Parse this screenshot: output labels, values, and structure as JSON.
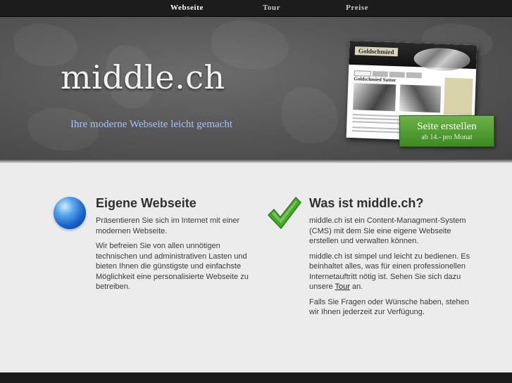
{
  "nav": {
    "items": [
      {
        "label": "Webseite"
      },
      {
        "label": "Tour"
      },
      {
        "label": "Preise"
      }
    ]
  },
  "hero": {
    "logo": "middle.ch",
    "tagline": "Ihre moderne Webseite leicht gemacht",
    "preview": {
      "site_title": "Goldschmied",
      "heading": "Goldschmied Sutter"
    },
    "cta": {
      "label": "Seite erstellen",
      "sub": "ab 14.- pro Monat"
    }
  },
  "left": {
    "icon": "globe-icon",
    "title": "Eigene Webseite",
    "p1": "Präsentieren Sie sich im Internet mit einer modernen Webseite.",
    "p2": "Wir befreien Sie von allen unnötigen technischen und administrativen Lasten und bieten Ihnen die günstigste und einfachste Möglichkeit eine personalisierte Webseite zu betreiben."
  },
  "right": {
    "icon": "checkmark-icon",
    "title": "Was ist middle.ch?",
    "p1": "middle.ch ist ein Content-Managment-System (CMS) mit dem Sie eine eigene Webseite erstellen und verwalten können.",
    "p2_before": "middle.ch ist simpel und leicht zu bedienen. Es beinhaltet alles, was für einen professionellen Internetauftritt nötig ist. Sehen Sie sich dazu unsere ",
    "p2_link": "Tour",
    "p2_after": " an.",
    "p3": "Falls Sie Fragen oder Wünsche haben, stehen wir Ihnen jederzeit zur Verfügung."
  },
  "colors": {
    "nav_bg": "#1c1c1c",
    "hero_bg": "#585858",
    "tagline": "#9fc3ff",
    "cta_green": "#4f9c30",
    "page_bg": "#ececec"
  }
}
